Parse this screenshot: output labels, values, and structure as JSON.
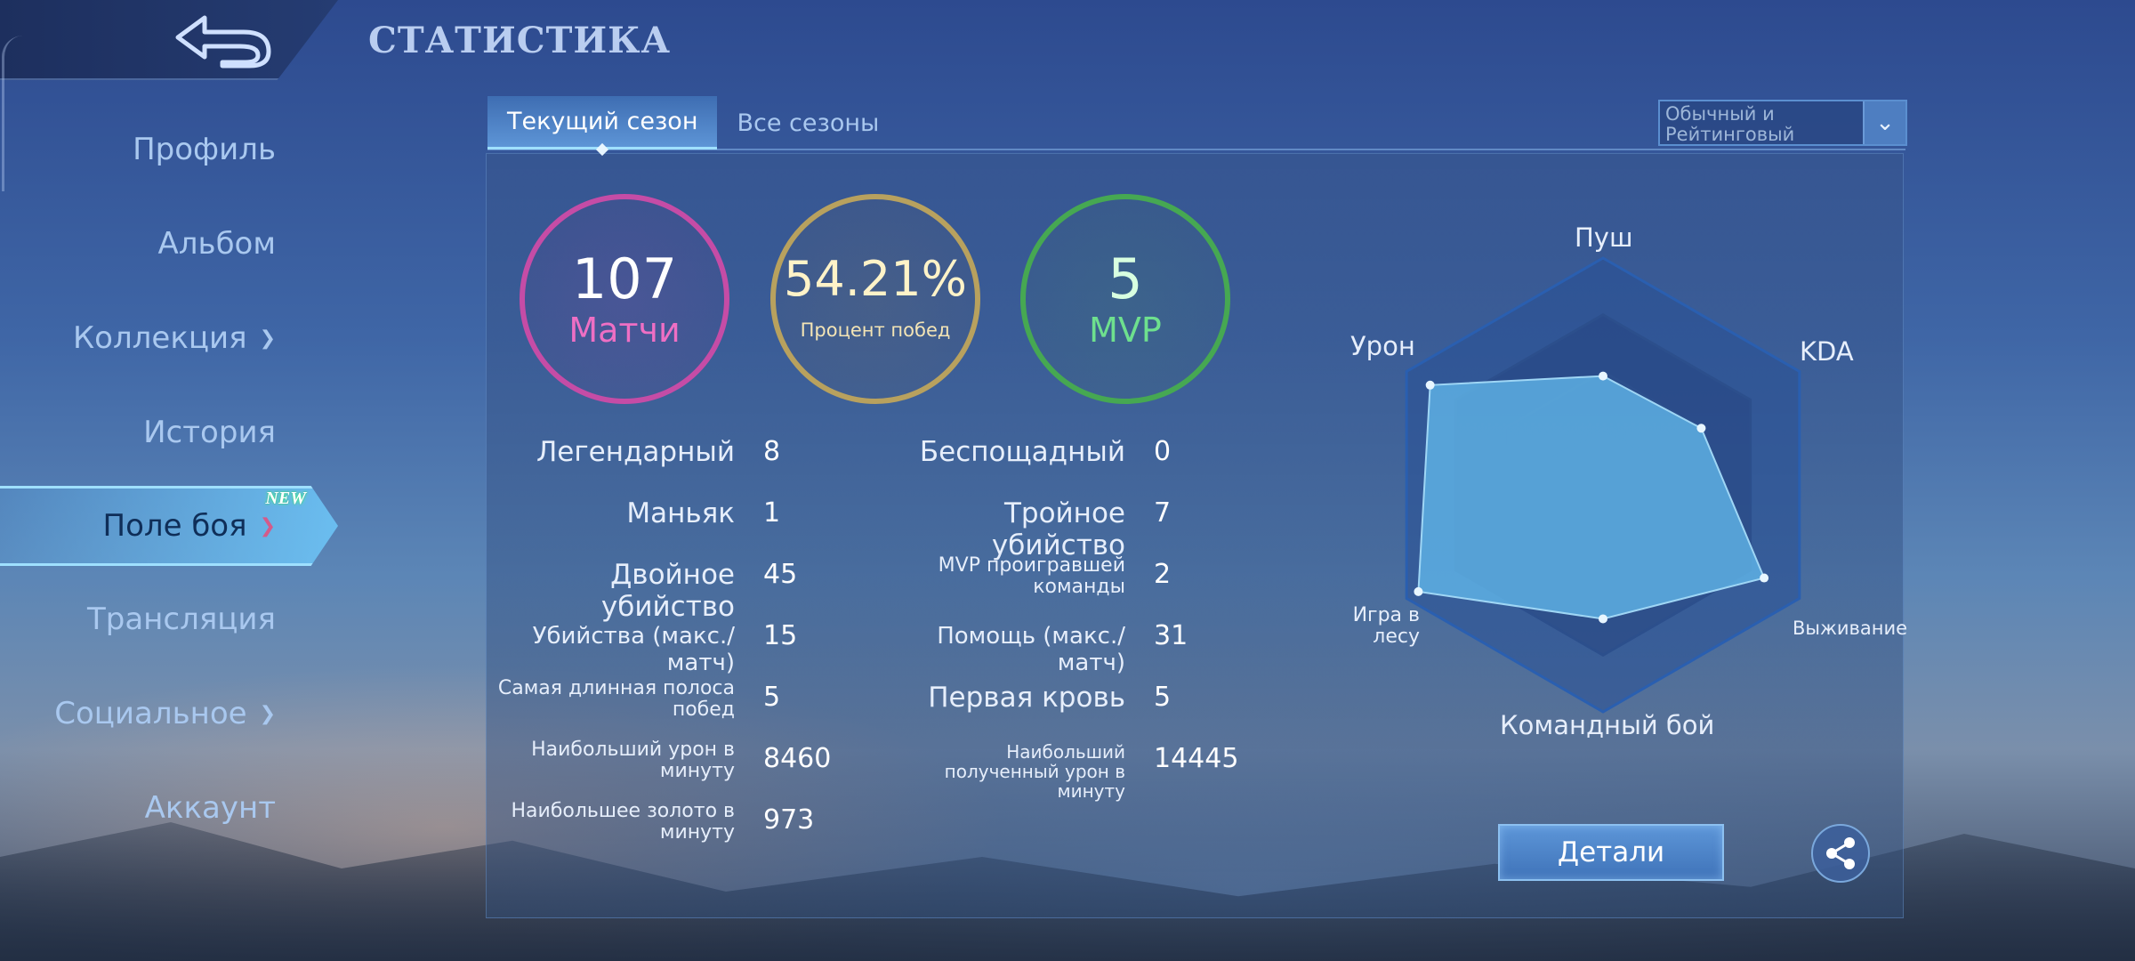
{
  "header": {
    "title": "СТАТИСТИКА",
    "back_icon": "back-arrow-icon"
  },
  "sidebar": {
    "items": [
      {
        "label": "Профиль",
        "has_chevron": false
      },
      {
        "label": "Альбом",
        "has_chevron": false
      },
      {
        "label": "Коллекция",
        "has_chevron": true
      },
      {
        "label": "История",
        "has_chevron": false
      },
      {
        "label": "Поле боя",
        "has_chevron": true,
        "active": true,
        "badge": "NEW"
      },
      {
        "label": "Трансляция",
        "has_chevron": false
      },
      {
        "label": "Социальное",
        "has_chevron": true
      },
      {
        "label": "Аккаунт",
        "has_chevron": false
      }
    ]
  },
  "tabs": [
    {
      "label": "Текущий сезон",
      "active": true
    },
    {
      "label": "Все сезоны",
      "active": false
    }
  ],
  "filter": {
    "label": "Обычный и Рейтинговый"
  },
  "summary": {
    "matches": {
      "value": "107",
      "label": "Матчи"
    },
    "winrate": {
      "value": "54.21%",
      "label": "Процент побед"
    },
    "mvp": {
      "value": "5",
      "label": "MVP"
    }
  },
  "stats_left": [
    {
      "label": "Легендарный",
      "value": "8"
    },
    {
      "label": "Маньяк",
      "value": "1"
    },
    {
      "label": "Двойное убийство",
      "value": "45"
    },
    {
      "label": "Убийства (макс./матч)",
      "value": "15"
    },
    {
      "label": "Самая длинная полоса побед",
      "value": "5"
    },
    {
      "label": "Наибольший урон в минуту",
      "value": "8460"
    },
    {
      "label": "Наибольшее золото в минуту",
      "value": "973"
    }
  ],
  "stats_right": [
    {
      "label": "Беспощадный",
      "value": "0"
    },
    {
      "label": "Тройное убийство",
      "value": "7"
    },
    {
      "label": "MVP проигравшей команды",
      "value": "2"
    },
    {
      "label": "Помощь (макс./матч)",
      "value": "31"
    },
    {
      "label": "Первая кровь",
      "value": "5"
    },
    {
      "label": "Наибольший полученный урон в минуту",
      "value": "14445"
    }
  ],
  "radar": {
    "axes": [
      "Пуш",
      "KDA",
      "Выживание",
      "Командный бой",
      "Игра в лесу",
      "Урон"
    ],
    "values": [
      0.48,
      0.5,
      0.82,
      0.59,
      0.94,
      0.88
    ],
    "fill_color": "#5fb3e6",
    "grid_color": "#2c4f8c"
  },
  "buttons": {
    "details": "Детали",
    "share_icon": "share-icon"
  },
  "colors": {
    "matches": "#c54ca6",
    "winrate": "#b8a15e",
    "mvp": "#46a852",
    "active_tab": "#9fe0ff"
  }
}
